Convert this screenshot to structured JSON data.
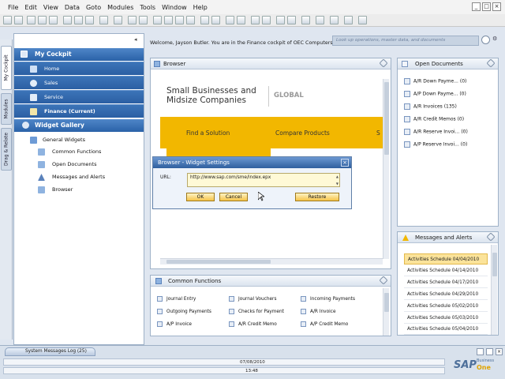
{
  "menu": {
    "items": [
      {
        "label": "File"
      },
      {
        "label": "Edit"
      },
      {
        "label": "View"
      },
      {
        "label": "Data"
      },
      {
        "label": "Goto"
      },
      {
        "label": "Modules"
      },
      {
        "label": "Tools"
      },
      {
        "label": "Window"
      },
      {
        "label": "Help"
      }
    ]
  },
  "vertical_tabs": [
    {
      "label": "My Cockpit"
    },
    {
      "label": "Modules"
    },
    {
      "label": "Drag & Relate"
    }
  ],
  "cockpit": {
    "welcome": "Welcome, Jayson Butler. You are in the Finance cockpit of OEC Computers.",
    "search_placeholder": "Look up operations, master data, and documents"
  },
  "nav": {
    "my_cockpit": "My Cockpit",
    "items": [
      {
        "label": "Home"
      },
      {
        "label": "Sales"
      },
      {
        "label": "Service"
      },
      {
        "label": "Finance (Current)"
      }
    ],
    "widget_gallery": "Widget Gallery",
    "general_widgets": "General Widgets",
    "widgets": [
      {
        "label": "Common Functions"
      },
      {
        "label": "Open Documents"
      },
      {
        "label": "Messages and Alerts"
      },
      {
        "label": "Browser"
      }
    ]
  },
  "browser": {
    "title": "Browser",
    "page_heading_line1": "Small Businesses and",
    "page_heading_line2": "Midsize Companies",
    "page_region": "GLOBAL",
    "links": [
      "Find a Solution",
      "Compare Products",
      "S"
    ]
  },
  "dialog": {
    "title": "Browser - Widget Settings",
    "url_label": "URL:",
    "url_value": "http://www.sap.com/sme/index.epx",
    "ok": "OK",
    "cancel": "Cancel",
    "restore": "Restore"
  },
  "open_documents": {
    "title": "Open Documents",
    "items": [
      {
        "label": "A/R Down Payme...",
        "count": "(0)"
      },
      {
        "label": "A/P Down Payme...",
        "count": "(0)"
      },
      {
        "label": "A/R Invoices",
        "count": "(135)"
      },
      {
        "label": "A/R Credit Memos",
        "count": "(0)"
      },
      {
        "label": "A/R Reserve Invoi...",
        "count": "(0)"
      },
      {
        "label": "A/P Reserve Invoi...",
        "count": "(0)"
      }
    ]
  },
  "messages_alerts": {
    "title": "Messages and Alerts",
    "items": [
      {
        "label": "Activities Schedule 04/04/2010"
      },
      {
        "label": "Activities Schedule 04/14/2010"
      },
      {
        "label": "Activities Schedule 04/17/2010"
      },
      {
        "label": "Activities Schedule 04/29/2010"
      },
      {
        "label": "Activities Schedule 05/02/2010"
      },
      {
        "label": "Activities Schedule 05/03/2010"
      },
      {
        "label": "Activities Schedule 05/04/2010"
      }
    ]
  },
  "common_functions": {
    "title": "Common Functions",
    "items": [
      {
        "label": "Journal Entry"
      },
      {
        "label": "Journal Vouchers"
      },
      {
        "label": "Incoming Payments"
      },
      {
        "label": "Outgoing Payments"
      },
      {
        "label": "Checks for Payment"
      },
      {
        "label": "A/R Invoice"
      },
      {
        "label": "A/P Invoice"
      },
      {
        "label": "A/R Credit Memo"
      },
      {
        "label": "A/P Credit Memo"
      }
    ]
  },
  "status": {
    "system_messages_log": "System Messages Log (25)",
    "date": "07/08/2010",
    "time": "13:48",
    "brand": "SAP",
    "brand_sub1": "Business",
    "brand_sub2": "One"
  },
  "colors": {
    "nav_blue": "#2b5fa3",
    "highlight": "#fbe39a",
    "sap_yellow": "#f2b700"
  }
}
